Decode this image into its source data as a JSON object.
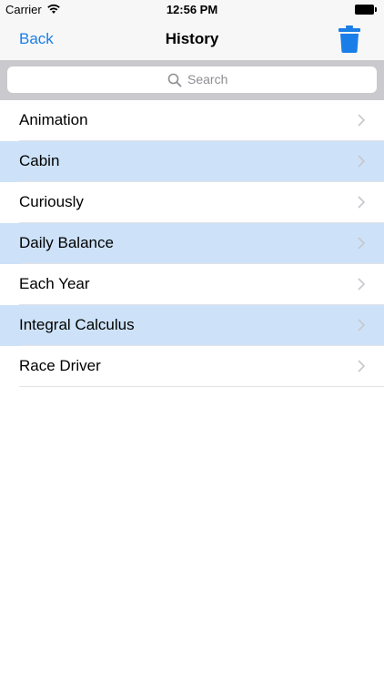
{
  "status_bar": {
    "carrier": "Carrier",
    "time": "12:56 PM",
    "wifi_icon": "wifi-icon",
    "battery_icon": "battery-icon"
  },
  "nav": {
    "back_label": "Back",
    "title": "History",
    "trash_icon": "trash-icon"
  },
  "search": {
    "placeholder": "Search",
    "icon": "search-icon"
  },
  "colors": {
    "accent": "#1a7ee8",
    "row_highlight": "#cde2f8",
    "search_bar_bg": "#c9c9ce",
    "chevron": "#c7c7cc"
  },
  "list": {
    "items": [
      {
        "label": "Animation",
        "highlighted": false
      },
      {
        "label": "Cabin",
        "highlighted": true
      },
      {
        "label": "Curiously",
        "highlighted": false
      },
      {
        "label": "Daily Balance",
        "highlighted": true
      },
      {
        "label": "Each Year",
        "highlighted": false
      },
      {
        "label": "Integral Calculus",
        "highlighted": true
      },
      {
        "label": "Race Driver",
        "highlighted": false
      }
    ]
  }
}
